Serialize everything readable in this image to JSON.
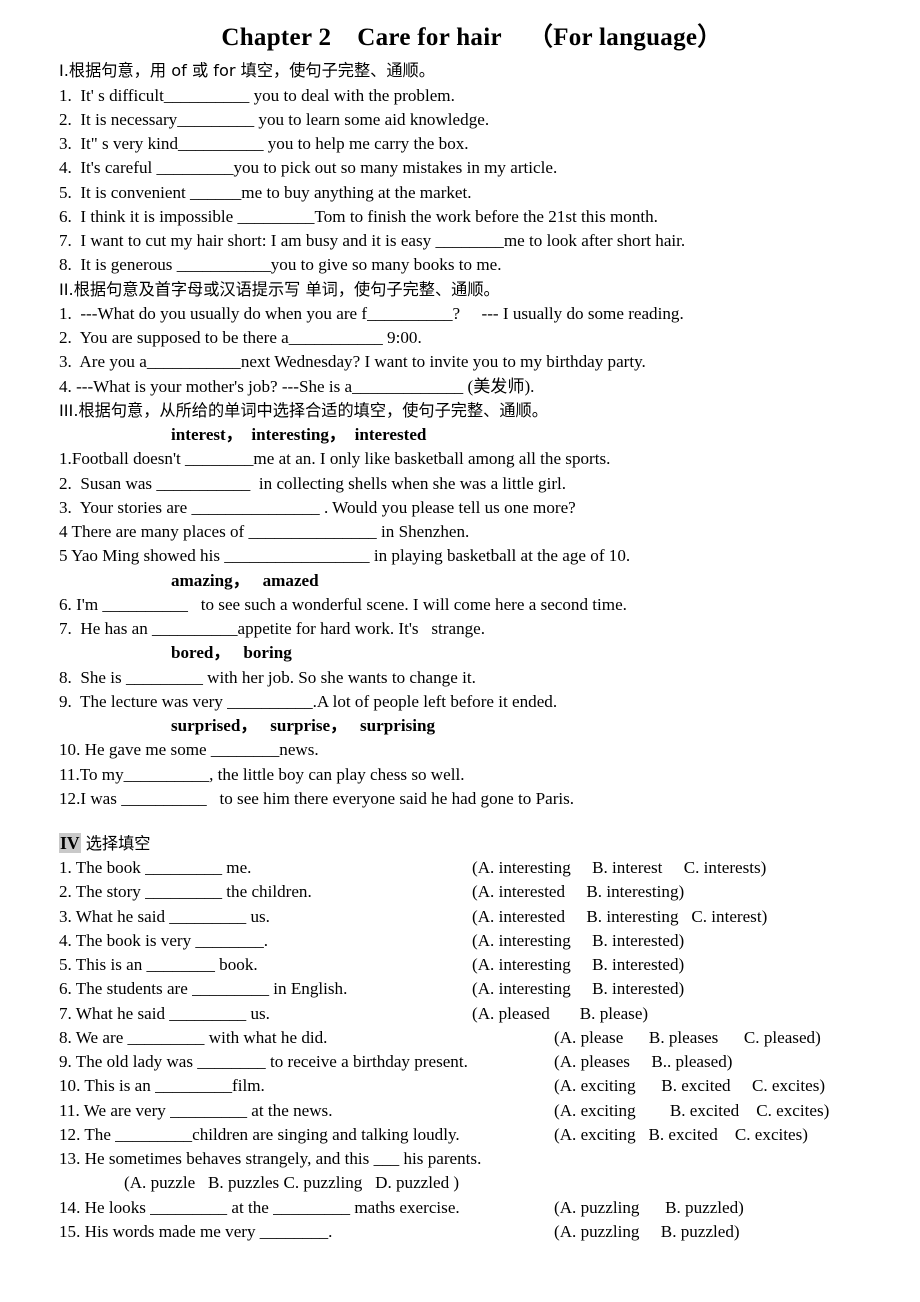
{
  "title": {
    "part1": "Chapter 2",
    "part2": "Care for hair",
    "part3": "（For language）"
  },
  "section1": {
    "heading": "I.根据句意，用 of 或 for 填空，使句子完整、通顺。",
    "items": [
      "1.  It' s difficult__________ you to deal with the problem.",
      "2.  It is necessary_________ you to learn some aid knowledge.",
      "3.  It\" s very kind__________ you to help me carry the box.",
      "4.  It's careful _________you to pick out so many mistakes in my article.",
      "5.  It is convenient ______me to buy anything at the market.",
      "6.  I think it is impossible _________Tom to finish the work before the 21st this month.",
      "7.  I want to cut my hair short: I am busy and it is easy ________me to look after short hair.",
      "8.  It is generous ___________you to give so many books to me."
    ]
  },
  "section2": {
    "heading": "II.根据句意及首字母或汉语提示写 单词，使句子完整、通顺。",
    "items": [
      "1.  ---What do you usually do when you are f__________?     --- I usually do some reading.",
      "2.  You are supposed to be there a___________ 9:00.",
      "3.  Are you a___________next Wednesday? I want to invite you to my birthday party.",
      "4. ---What is your mother's job? ---She is a_____________ (美发师)."
    ]
  },
  "section3": {
    "heading": "III.根据句意，从所给的单词中选择合适的填空，使句子完整、通顺。",
    "wordbank1": "interest，  interesting，  interested",
    "items_a": [
      "1.Football doesn't ________me at an. I only like basketball among all the sports.",
      "2.  Susan was ___________  in collecting shells when she was a little girl.",
      "3.  Your stories are _______________ . Would you please tell us one more?",
      "4 There are many places of _______________ in Shenzhen.",
      "5 Yao Ming showed his _________________ in playing basketball at the age of 10."
    ],
    "wordbank2": "amazing，   amazed",
    "items_b": [
      "6. I'm __________   to see such a wonderful scene. I will come here a second time.",
      "7.  He has an __________appetite for hard work. It's   strange."
    ],
    "wordbank3": "bored，   boring",
    "items_c": [
      "8.  She is _________ with her job. So she wants to change it.",
      "9.  The lecture was very __________.A lot of people left before it ended."
    ],
    "wordbank4": "surprised，   surprise，   surprising",
    "items_d": [
      "10. He gave me some ________news.",
      "11.To my__________, the little boy can play chess so well.",
      "12.I was __________   to see him there everyone said he had gone to Paris."
    ]
  },
  "section4": {
    "roman": "IV",
    "heading_cn": " 选择填空",
    "items": [
      {
        "stem": "1. The book _________ me.",
        "opts": "(A. interesting     B. interest     C. interests)",
        "wide": false
      },
      {
        "stem": "2. The story _________ the children.",
        "opts": "(A. interested     B. interesting)",
        "wide": false
      },
      {
        "stem": "3. What he said _________ us.",
        "opts": "(A. interested     B. interesting   C. interest)",
        "wide": false
      },
      {
        "stem": "4. The book is very ________.",
        "opts": "(A. interesting     B. interested)",
        "wide": false
      },
      {
        "stem": "5. This is an ________ book.",
        "opts": "(A. interesting     B. interested)",
        "wide": false
      },
      {
        "stem": "6. The students are _________ in English.",
        "opts": "(A. interesting     B. interested)",
        "wide": false
      },
      {
        "stem": "7. What he said _________ us.",
        "opts": "(A. pleased       B. please)",
        "wide": false
      },
      {
        "stem": "8. We are _________ with what he did.",
        "opts": "(A. please      B. pleases      C. pleased)",
        "wide": true
      },
      {
        "stem": "9. The old lady was ________ to receive a birthday present.",
        "opts": "(A. pleases     B.. pleased)",
        "wide": true
      },
      {
        "stem": "10. This is an _________film.",
        "opts": "(A. exciting      B. excited     C. excites)",
        "wide": true
      },
      {
        "stem": "11. We are very _________ at the news.",
        "opts": "(A. exciting        B. excited    C. excites)",
        "wide": true
      },
      {
        "stem": "12. The _________children are singing and talking loudly.",
        "opts": "(A. exciting   B. excited    C. excites)",
        "wide": true
      }
    ],
    "item13": "13. He sometimes behaves strangely, and this ___ his parents.",
    "item13_opts": "(A. puzzle   B. puzzles C. puzzling   D. puzzled )",
    "items_tail": [
      {
        "stem": "14. He looks _________ at the _________ maths exercise.",
        "opts": "(A. puzzling      B. puzzled)",
        "wide": true
      },
      {
        "stem": "15. His words made me very ________.",
        "opts": "(A. puzzling     B. puzzled)",
        "wide": true
      }
    ]
  }
}
